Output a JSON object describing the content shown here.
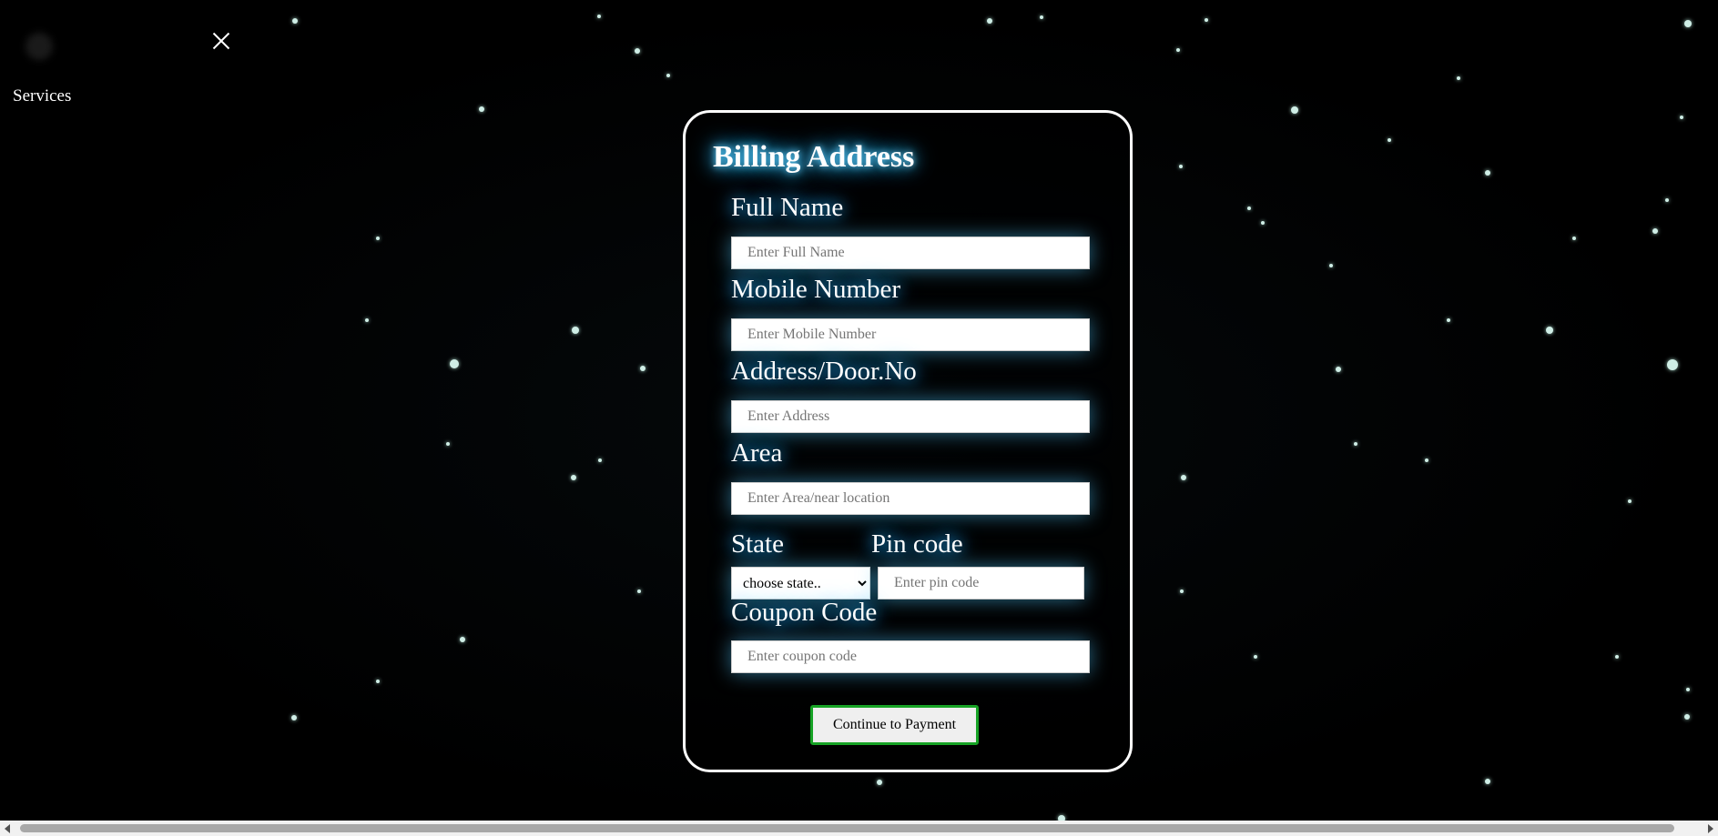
{
  "nav": {
    "services_label": "Services",
    "close_icon": "close-icon"
  },
  "form": {
    "title": "Billing Address",
    "full_name": {
      "label": "Full Name",
      "placeholder": "Enter Full Name",
      "value": ""
    },
    "mobile": {
      "label": "Mobile Number",
      "placeholder": "Enter Mobile Number",
      "value": ""
    },
    "address": {
      "label": "Address/Door.No",
      "placeholder": "Enter Address",
      "value": ""
    },
    "area": {
      "label": "Area",
      "placeholder": "Enter Area/near location",
      "value": ""
    },
    "state": {
      "label": "State",
      "selected": "choose state.."
    },
    "pincode": {
      "label": "Pin code",
      "placeholder": "Enter pin code",
      "value": ""
    },
    "coupon": {
      "label": "Coupon Code",
      "placeholder": "Enter coupon code",
      "value": ""
    },
    "submit_label": "Continue to Payment"
  },
  "colors": {
    "background": "#000000",
    "glow": "#2fb6ff",
    "button_border": "#17a325",
    "card_border": "#ffffff"
  }
}
